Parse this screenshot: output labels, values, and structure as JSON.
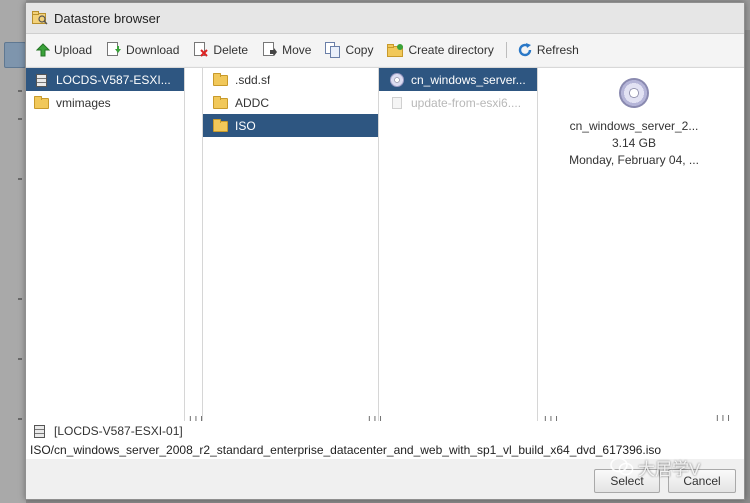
{
  "dialog": {
    "title": "Datastore browser"
  },
  "toolbar": {
    "upload": "Upload",
    "download": "Download",
    "delete": "Delete",
    "move": "Move",
    "copy": "Copy",
    "create_directory": "Create directory",
    "refresh": "Refresh"
  },
  "columns": {
    "datastores": [
      {
        "label": "LOCDS-V587-ESXI...",
        "icon": "datastore-icon",
        "selected": true
      },
      {
        "label": "vmimages",
        "icon": "folder-icon",
        "selected": false
      }
    ],
    "folders": [
      {
        "label": ".sdd.sf",
        "icon": "folder-icon",
        "selected": false
      },
      {
        "label": "ADDC",
        "icon": "folder-icon",
        "selected": false
      },
      {
        "label": "ISO",
        "icon": "folder-icon",
        "selected": true
      }
    ],
    "files": [
      {
        "label": "cn_windows_server...",
        "icon": "disc-icon",
        "selected": true
      },
      {
        "label": "update-from-esxi6....",
        "icon": "file-icon",
        "selected": false,
        "disabled": true
      }
    ]
  },
  "preview": {
    "name": "cn_windows_server_2...",
    "size": "3.14 GB",
    "modified": "Monday, February 04, ..."
  },
  "status": {
    "datastore": "[LOCDS-V587-ESXI-01]",
    "path": "ISO/cn_windows_server_2008_r2_standard_enterprise_datacenter_and_web_with_sp1_vl_build_x64_dvd_617396.iso"
  },
  "buttons": {
    "select": "Select",
    "cancel": "Cancel"
  },
  "watermark": {
    "text": "大居学V"
  },
  "colors": {
    "selection": "#2e5681",
    "refresh": "#2a78c7",
    "upload": "#3aa23a"
  }
}
